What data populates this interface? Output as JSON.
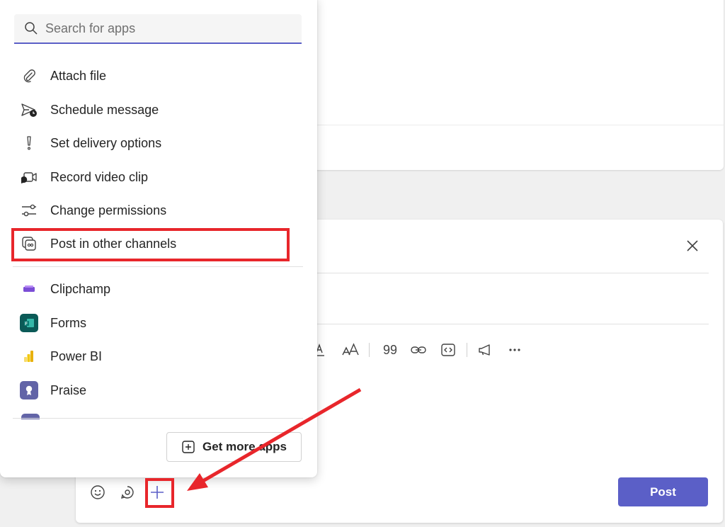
{
  "search": {
    "placeholder": "Search for apps"
  },
  "menu": {
    "actions": [
      {
        "label": "Attach file",
        "icon": "paperclip-icon"
      },
      {
        "label": "Schedule message",
        "icon": "schedule-send-icon"
      },
      {
        "label": "Set delivery options",
        "icon": "exclamation-icon"
      },
      {
        "label": "Record video clip",
        "icon": "video-record-icon"
      },
      {
        "label": "Change permissions",
        "icon": "sliders-icon"
      },
      {
        "label": "Post in other channels",
        "icon": "post-channels-icon"
      }
    ],
    "apps": [
      {
        "label": "Clipchamp",
        "icon": "clipchamp-icon"
      },
      {
        "label": "Forms",
        "icon": "forms-icon"
      },
      {
        "label": "Power BI",
        "icon": "powerbi-icon"
      },
      {
        "label": "Praise",
        "icon": "praise-icon"
      }
    ],
    "get_more_label": "Get more apps"
  },
  "compose": {
    "post_label": "Post"
  },
  "colors": {
    "accent": "#5b5fc7",
    "annotation": "#e8262b",
    "forms": "#0b5a57",
    "powerbi": "#f2c811",
    "praise": "#6264a7"
  }
}
